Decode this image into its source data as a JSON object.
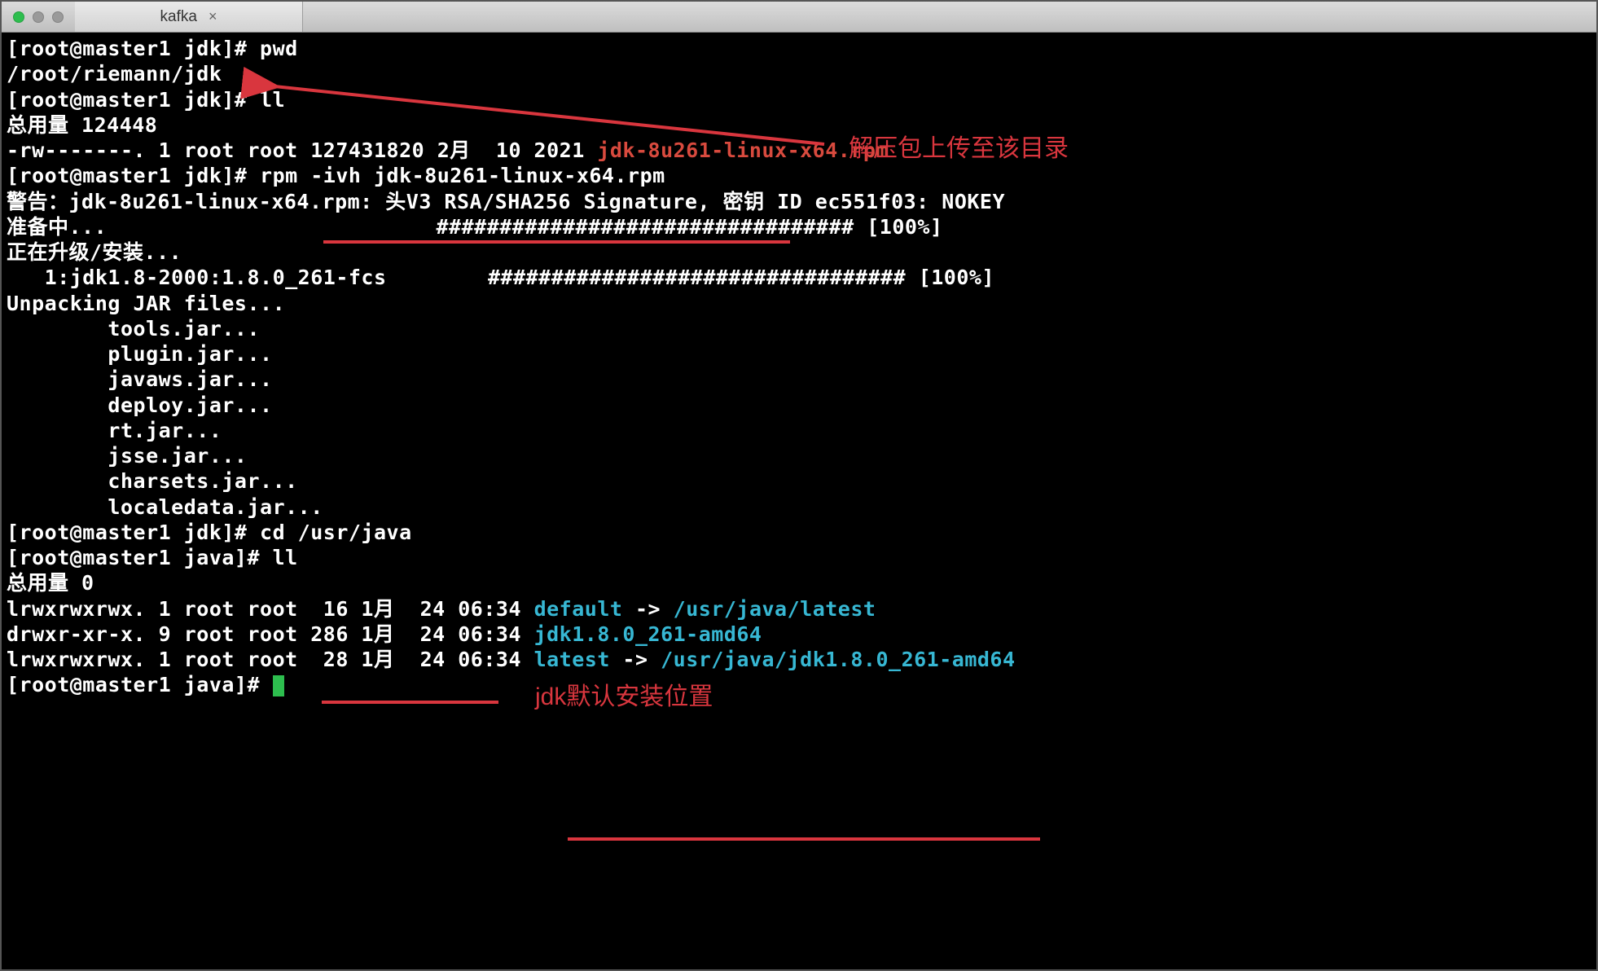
{
  "tab": {
    "title": "kafka",
    "close": "×"
  },
  "prompt": {
    "jdk": "[root@master1 jdk]# ",
    "java": "[root@master1 java]# "
  },
  "cmd": {
    "pwd": "pwd",
    "pwd_out": "/root/riemann/jdk",
    "ll": "ll",
    "total_jdk": "总用量 124448",
    "ls_rpm_perm": "-rw-------. 1 root root 127431820 2月  10 2021 ",
    "ls_rpm_file": "jdk-8u261-linux-x64.rpm",
    "rpm": "rpm -ivh jdk-8u261-linux-x64.rpm",
    "warn": "警告：jdk-8u261-linux-x64.rpm: 头V3 RSA/SHA256 Signature, 密钥 ID ec551f03: NOKEY",
    "preparing": "准备中...                          ################################# [100%]",
    "upgrading": "正在升级/安装...",
    "pkg": "   1:jdk1.8-2000:1.8.0_261-fcs        ################################# [100%]",
    "unpack": "Unpacking JAR files...",
    "jar1": "        tools.jar...",
    "jar2": "        plugin.jar...",
    "jar3": "        javaws.jar...",
    "jar4": "        deploy.jar...",
    "jar5": "        rt.jar...",
    "jar6": "        jsse.jar...",
    "jar7": "        charsets.jar...",
    "jar8": "        localedata.jar...",
    "cd": "cd /usr/java",
    "total_java": "总用量 0",
    "l1a": "lrwxrwxrwx. 1 root root  16 1月  24 06:34 ",
    "l1b": "default",
    "l1c": " -> ",
    "l1d": "/usr/java/latest",
    "l2a": "drwxr-xr-x. 9 root root 286 1月  24 06:34 ",
    "l2b": "jdk1.8.0_261-amd64",
    "l3a": "lrwxrwxrwx. 1 root root  28 1月  24 06:34 ",
    "l3b": "latest",
    "l3c": " -> ",
    "l3d": "/usr/java/jdk1.8.0_261-amd64"
  },
  "annot": {
    "a1": "解压包上传至该目录",
    "a2": "jdk默认安装位置"
  }
}
